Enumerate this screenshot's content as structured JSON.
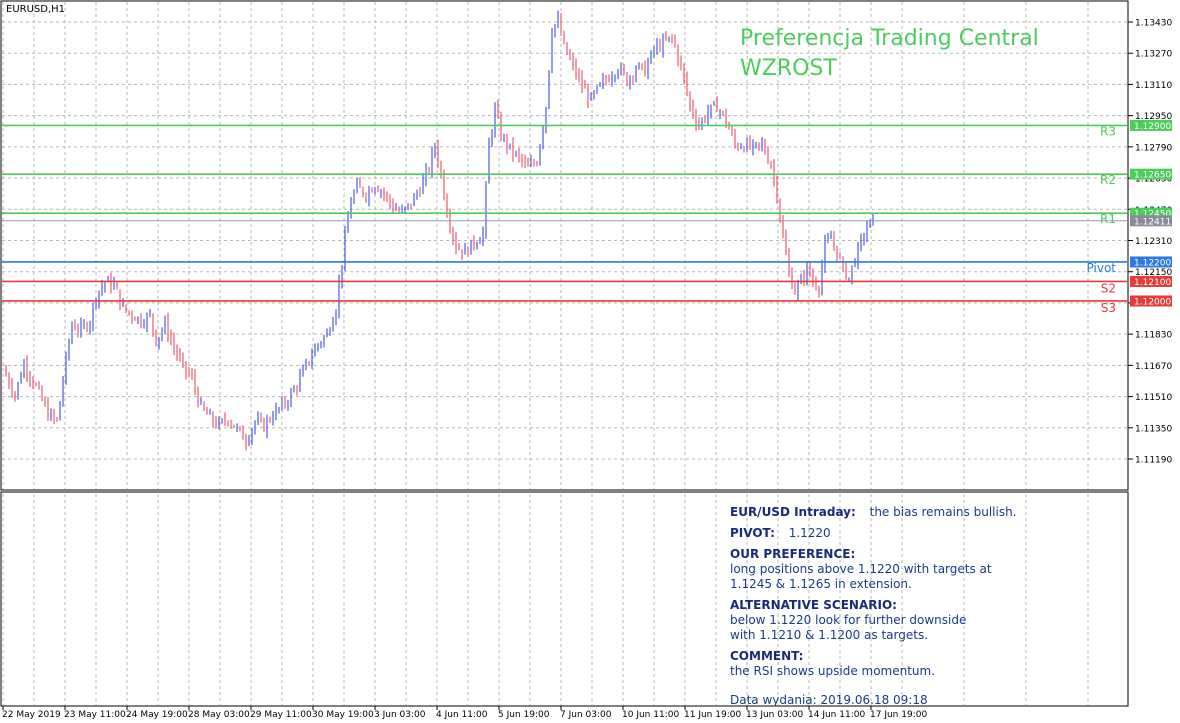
{
  "window": {
    "symbol_label": "EURUSD,H1"
  },
  "overlay": {
    "title_line1": "Preferencja Trading Central",
    "title_line2": "WZROST"
  },
  "commentary": {
    "intraday_label": "EUR/USD Intraday:",
    "intraday_text": "the bias remains bullish.",
    "pivot_label": "PIVOT:",
    "pivot_value": "1.1220",
    "preference_label": "OUR PREFERENCE:",
    "preference_line1": "long positions above 1.1220 with targets at",
    "preference_line2": "1.1245 & 1.1265 in extension.",
    "alternative_label": "ALTERNATIVE SCENARIO:",
    "alternative_line1": "below 1.1220 look for further downside",
    "alternative_line2": "with 1.1210 & 1.1200 as targets.",
    "comment_label": "COMMENT:",
    "comment_text": "the RSI shows upside momentum.",
    "date_text": "Data wydania:  2019.06.18 09:18"
  },
  "colors": {
    "bull": "#4a5ae8",
    "bear": "#f05a6a",
    "resistance": "#4ccc5a",
    "pivot": "#2a7ae0",
    "support": "#e83a3a",
    "grid": "#b8b8b8",
    "current_price_tag": "#8a8a9a"
  },
  "chart_data": {
    "type": "candlestick",
    "symbol": "EURUSD",
    "timeframe": "H1",
    "ylim": [
      1.1108,
      1.1352
    ],
    "y_ticks": [
      "1.13430",
      "1.13270",
      "1.13110",
      "1.12950",
      "1.12790",
      "1.12630",
      "1.12470",
      "1.12310",
      "1.12150",
      "1.11990",
      "1.11830",
      "1.11670",
      "1.11510",
      "1.11350",
      "1.11190"
    ],
    "x_ticks": [
      "22 May 2019",
      "23 May 11:00",
      "24 May 19:00",
      "28 May 03:00",
      "29 May 11:00",
      "30 May 19:00",
      "3 Jun 03:00",
      "4 Jun 11:00",
      "5 Jun 19:00",
      "7 Jun 03:00",
      "10 Jun 11:00",
      "11 Jun 19:00",
      "13 Jun 03:00",
      "14 Jun 11:00",
      "17 Jun 19:00"
    ],
    "levels": [
      {
        "name": "R3",
        "value": 1.129,
        "tag": "1.12900",
        "kind": "resistance"
      },
      {
        "name": "R2",
        "value": 1.1265,
        "tag": "1.12650",
        "kind": "resistance"
      },
      {
        "name": "R1",
        "value": 1.1245,
        "tag": "1.12450",
        "kind": "resistance"
      },
      {
        "name": "Pivot",
        "value": 1.122,
        "tag": "1.12200",
        "kind": "pivot"
      },
      {
        "name": "S2",
        "value": 1.121,
        "tag": "1.12100",
        "kind": "support"
      },
      {
        "name": "S3",
        "value": 1.12,
        "tag": "1.12000",
        "kind": "support"
      }
    ],
    "current_price": {
      "value": 1.12411,
      "tag": "1.12411"
    },
    "price_path": [
      [
        0,
        1.1165
      ],
      [
        4,
        1.1152
      ],
      [
        7,
        1.1168
      ],
      [
        11,
        1.1156
      ],
      [
        15,
        1.1142
      ],
      [
        18,
        1.1138
      ],
      [
        21,
        1.117
      ],
      [
        23,
        1.1188
      ],
      [
        26,
        1.1185
      ],
      [
        29,
        1.119
      ],
      [
        31,
        1.1203
      ],
      [
        34,
        1.121
      ],
      [
        37,
        1.1208
      ],
      [
        40,
        1.1196
      ],
      [
        43,
        1.1193
      ],
      [
        46,
        1.119
      ],
      [
        49,
        1.1192
      ],
      [
        51,
        1.118
      ],
      [
        54,
        1.1188
      ],
      [
        57,
        1.1176
      ],
      [
        60,
        1.1166
      ],
      [
        63,
        1.116
      ],
      [
        66,
        1.1145
      ],
      [
        69,
        1.114
      ],
      [
        72,
        1.1136
      ],
      [
        75,
        1.114
      ],
      [
        78,
        1.1134
      ],
      [
        81,
        1.1129
      ],
      [
        84,
        1.1138
      ],
      [
        87,
        1.1136
      ],
      [
        90,
        1.1142
      ],
      [
        93,
        1.1146
      ],
      [
        96,
        1.1152
      ],
      [
        99,
        1.116
      ],
      [
        102,
        1.117
      ],
      [
        105,
        1.1178
      ],
      [
        108,
        1.1183
      ],
      [
        111,
        1.1197
      ],
      [
        114,
        1.1232
      ],
      [
        116,
        1.1252
      ],
      [
        118,
        1.1258
      ],
      [
        121,
        1.1255
      ],
      [
        124,
        1.126
      ],
      [
        127,
        1.1255
      ],
      [
        130,
        1.1248
      ],
      [
        133,
        1.1245
      ],
      [
        136,
        1.125
      ],
      [
        139,
        1.1258
      ],
      [
        142,
        1.1268
      ],
      [
        144,
        1.128
      ],
      [
        146,
        1.1265
      ],
      [
        148,
        1.1246
      ],
      [
        151,
        1.1228
      ],
      [
        154,
        1.1225
      ],
      [
        157,
        1.123
      ],
      [
        160,
        1.1235
      ],
      [
        162,
        1.128
      ],
      [
        164,
        1.1298
      ],
      [
        166,
        1.1285
      ],
      [
        169,
        1.1278
      ],
      [
        172,
        1.1273
      ],
      [
        175,
        1.1268
      ],
      [
        178,
        1.1272
      ],
      [
        181,
        1.13
      ],
      [
        183,
        1.134
      ],
      [
        185,
        1.1343
      ],
      [
        187,
        1.133
      ],
      [
        190,
        1.132
      ],
      [
        193,
        1.131
      ],
      [
        196,
        1.1303
      ],
      [
        199,
        1.131
      ],
      [
        202,
        1.1315
      ],
      [
        205,
        1.132
      ],
      [
        208,
        1.1313
      ],
      [
        211,
        1.132
      ],
      [
        214,
        1.1318
      ],
      [
        217,
        1.1329
      ],
      [
        220,
        1.1332
      ],
      [
        223,
        1.1335
      ],
      [
        226,
        1.132
      ],
      [
        229,
        1.13
      ],
      [
        232,
        1.129
      ],
      [
        235,
        1.1297
      ],
      [
        238,
        1.13
      ],
      [
        241,
        1.1292
      ],
      [
        244,
        1.128
      ],
      [
        247,
        1.128
      ],
      [
        250,
        1.1278
      ],
      [
        253,
        1.128
      ],
      [
        256,
        1.127
      ],
      [
        258,
        1.1255
      ],
      [
        260,
        1.1232
      ],
      [
        262,
        1.1214
      ],
      [
        264,
        1.1205
      ],
      [
        266,
        1.121
      ],
      [
        268,
        1.1217
      ],
      [
        270,
        1.121
      ],
      [
        272,
        1.1208
      ],
      [
        274,
        1.1228
      ],
      [
        276,
        1.1232
      ],
      [
        278,
        1.1225
      ],
      [
        280,
        1.1216
      ],
      [
        282,
        1.1212
      ],
      [
        284,
        1.1222
      ],
      [
        286,
        1.123
      ],
      [
        288,
        1.1238
      ],
      [
        290,
        1.1241
      ]
    ]
  }
}
